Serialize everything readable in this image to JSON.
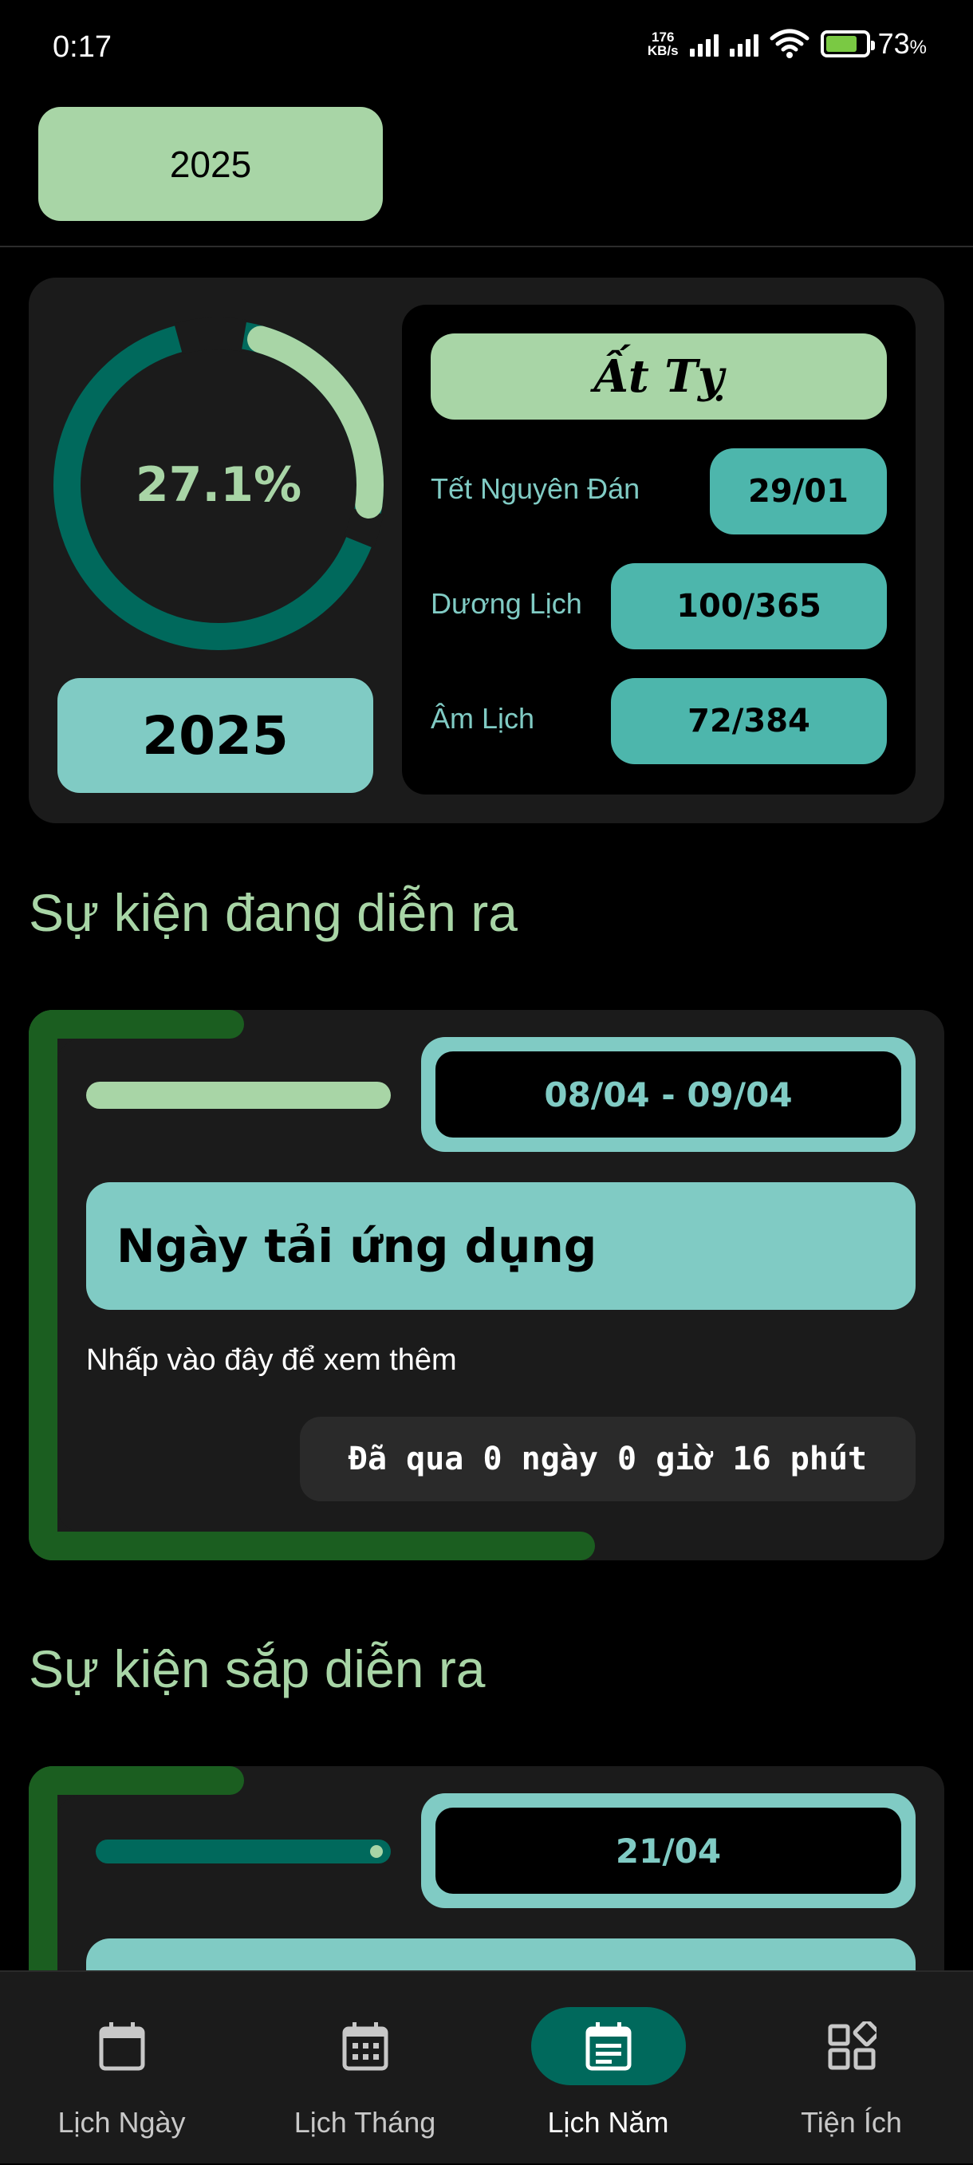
{
  "status_bar": {
    "time": "0:17",
    "net_speed_value": "176",
    "net_speed_unit": "KB/s",
    "battery_percent": "73",
    "battery_percent_sign": "%"
  },
  "year_selector": {
    "label": "2025"
  },
  "summary": {
    "progress_percent_text": "27.1%",
    "progress_fraction": 0.271,
    "year": "2025",
    "can_chi": "Ất Tỵ",
    "rows": [
      {
        "label": "Tết Nguyên Đán",
        "value": "29/01"
      },
      {
        "label": "Dương Lịch",
        "value": "100/365"
      },
      {
        "label": "Âm Lịch",
        "value": "72/384"
      }
    ]
  },
  "sections": {
    "ongoing_title": "Sự kiện đang diễn ra",
    "upcoming_title": "Sự kiện sắp diễn ra"
  },
  "ongoing_event": {
    "date_range": "08/04 - 09/04",
    "title": "Ngày tải ứng dụng",
    "description": "Nhấp vào đây để xem thêm",
    "elapsed": "Đã qua 0 ngày 0 giờ 16 phút",
    "progress_fraction": 1.0
  },
  "upcoming_event": {
    "date": "21/04"
  },
  "bottom_nav": [
    {
      "label": "Lịch Ngày",
      "icon": "calendar-blank-icon",
      "active": false
    },
    {
      "label": "Lịch Tháng",
      "icon": "calendar-month-icon",
      "active": false
    },
    {
      "label": "Lịch Năm",
      "icon": "calendar-year-icon",
      "active": true
    },
    {
      "label": "Tiện Ích",
      "icon": "widgets-icon",
      "active": false
    }
  ],
  "colors": {
    "accent_green_light": "#a8d5a6",
    "accent_teal": "#80cbc4",
    "accent_teal_dark": "#00695c",
    "frame_green": "#1b5e20"
  }
}
